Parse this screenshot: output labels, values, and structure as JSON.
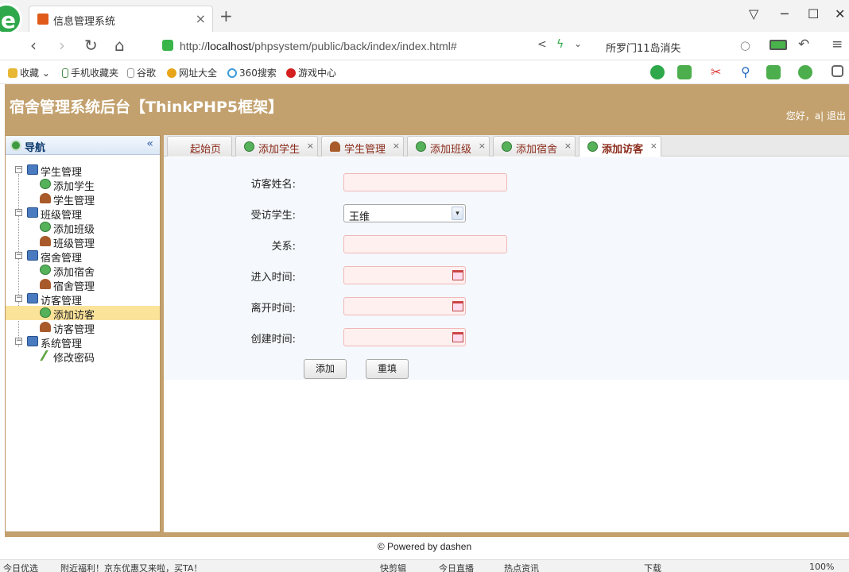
{
  "browser": {
    "tab_title": "信息管理系统",
    "url_prefix": "http://",
    "url_host": "localhost",
    "url_path": "/phpsystem/public/back/index/index.html#",
    "search_text": "所罗门11岛消失",
    "bookmarks": [
      "收藏",
      "手机收藏夹",
      "谷歌",
      "网址大全",
      "360搜索",
      "游戏中心"
    ]
  },
  "app": {
    "title": "宿舍管理系统后台【ThinkPHP5框架】",
    "greeting": "您好，a|",
    "logout": "退出"
  },
  "sidebar": {
    "title": "导航",
    "groups": [
      {
        "label": "学生管理",
        "items": [
          "添加学生",
          "学生管理"
        ]
      },
      {
        "label": "班级管理",
        "items": [
          "添加班级",
          "班级管理"
        ]
      },
      {
        "label": "宿舍管理",
        "items": [
          "添加宿舍",
          "宿舍管理"
        ]
      },
      {
        "label": "访客管理",
        "items": [
          "添加访客",
          "访客管理"
        ]
      },
      {
        "label": "系统管理",
        "items": [
          "修改密码"
        ]
      }
    ]
  },
  "tabs": [
    {
      "label": "起始页"
    },
    {
      "label": "添加学生"
    },
    {
      "label": "学生管理"
    },
    {
      "label": "添加班级"
    },
    {
      "label": "添加宿舍"
    },
    {
      "label": "添加访客"
    }
  ],
  "form": {
    "visitor_name_label": "访客姓名:",
    "student_label": "受访学生:",
    "student_value": "王维",
    "relation_label": "关系:",
    "enter_label": "进入时间:",
    "leave_label": "离开时间:",
    "create_label": "创建时间:",
    "add_button": "添加",
    "reset_button": "重填"
  },
  "footer": "© Powered by dashen",
  "statusbar": [
    "今日优选",
    "附近福利！京东优惠又来啦，买TA！",
    "快剪辑",
    "今日直播",
    "热点资讯",
    "下载",
    "100%"
  ]
}
